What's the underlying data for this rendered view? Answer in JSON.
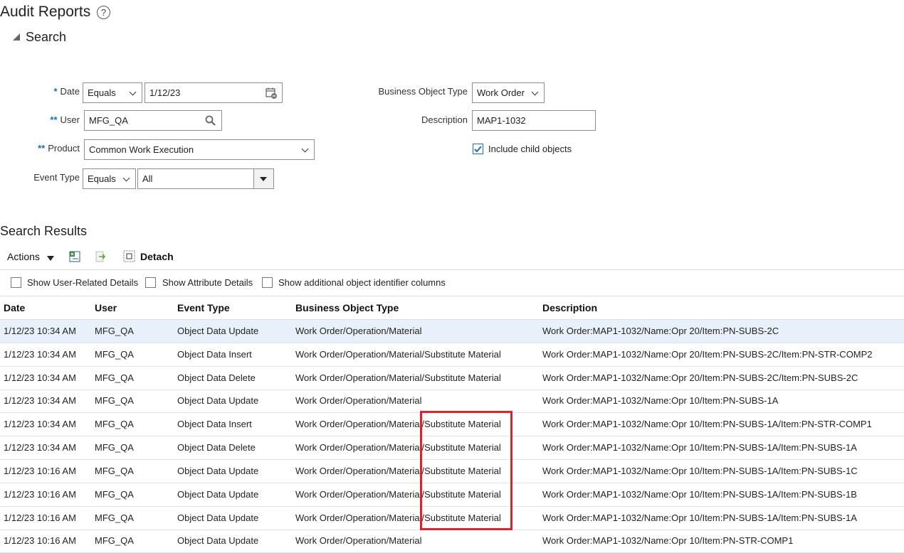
{
  "page": {
    "title": "Audit Reports",
    "help_glyph": "?"
  },
  "search": {
    "header": "Search",
    "date": {
      "label": "Date",
      "required_mark": "*",
      "operator": "Equals",
      "value": "1/12/23"
    },
    "user": {
      "label": "User",
      "required_mark": "**",
      "value": "MFG_QA"
    },
    "product": {
      "label": "Product",
      "required_mark": "**",
      "value": "Common Work Execution"
    },
    "event_type": {
      "label": "Event Type",
      "operator": "Equals",
      "value": "All"
    },
    "business_object_type": {
      "label": "Business Object Type",
      "value": "Work Order"
    },
    "description": {
      "label": "Description",
      "value": "MAP1-1032"
    },
    "include_child": {
      "label": "Include child objects",
      "checked": true
    }
  },
  "results": {
    "title": "Search Results",
    "toolbar": {
      "actions_label": "Actions",
      "detach_label": "Detach"
    },
    "options": [
      {
        "label": "Show User-Related Details",
        "checked": false
      },
      {
        "label": "Show Attribute Details",
        "checked": false
      },
      {
        "label": "Show additional object identifier columns",
        "checked": false
      }
    ],
    "columns": [
      "Date",
      "User",
      "Event Type",
      "Business Object Type",
      "Description"
    ],
    "rows": [
      [
        "1/12/23 10:34 AM",
        "MFG_QA",
        "Object Data Update",
        "Work Order/Operation/Material",
        "Work Order:MAP1-1032/Name:Opr 20/Item:PN-SUBS-2C"
      ],
      [
        "1/12/23 10:34 AM",
        "MFG_QA",
        "Object Data Insert",
        "Work Order/Operation/Material/Substitute Material",
        "Work Order:MAP1-1032/Name:Opr 20/Item:PN-SUBS-2C/Item:PN-STR-COMP2"
      ],
      [
        "1/12/23 10:34 AM",
        "MFG_QA",
        "Object Data Delete",
        "Work Order/Operation/Material/Substitute Material",
        "Work Order:MAP1-1032/Name:Opr 20/Item:PN-SUBS-2C/Item:PN-SUBS-2C"
      ],
      [
        "1/12/23 10:34 AM",
        "MFG_QA",
        "Object Data Update",
        "Work Order/Operation/Material",
        "Work Order:MAP1-1032/Name:Opr 10/Item:PN-SUBS-1A"
      ],
      [
        "1/12/23 10:34 AM",
        "MFG_QA",
        "Object Data Insert",
        "Work Order/Operation/Material/Substitute Material",
        "Work Order:MAP1-1032/Name:Opr 10/Item:PN-SUBS-1A/Item:PN-STR-COMP1"
      ],
      [
        "1/12/23 10:34 AM",
        "MFG_QA",
        "Object Data Delete",
        "Work Order/Operation/Material/Substitute Material",
        "Work Order:MAP1-1032/Name:Opr 10/Item:PN-SUBS-1A/Item:PN-SUBS-1A"
      ],
      [
        "1/12/23 10:16 AM",
        "MFG_QA",
        "Object Data Update",
        "Work Order/Operation/Material/Substitute Material",
        "Work Order:MAP1-1032/Name:Opr 10/Item:PN-SUBS-1A/Item:PN-SUBS-1C"
      ],
      [
        "1/12/23 10:16 AM",
        "MFG_QA",
        "Object Data Update",
        "Work Order/Operation/Material/Substitute Material",
        "Work Order:MAP1-1032/Name:Opr 10/Item:PN-SUBS-1A/Item:PN-SUBS-1B"
      ],
      [
        "1/12/23 10:16 AM",
        "MFG_QA",
        "Object Data Update",
        "Work Order/Operation/Material/Substitute Material",
        "Work Order:MAP1-1032/Name:Opr 10/Item:PN-SUBS-1A/Item:PN-SUBS-1A"
      ],
      [
        "1/12/23 10:16 AM",
        "MFG_QA",
        "Object Data Update",
        "Work Order/Operation/Material",
        "Work Order:MAP1-1032/Name:Opr 10/Item:PN-STR-COMP1"
      ]
    ]
  },
  "colors": {
    "required": "#1d6fa9",
    "selected_row": "#e8f1fb",
    "highlight": "#e0202a"
  }
}
